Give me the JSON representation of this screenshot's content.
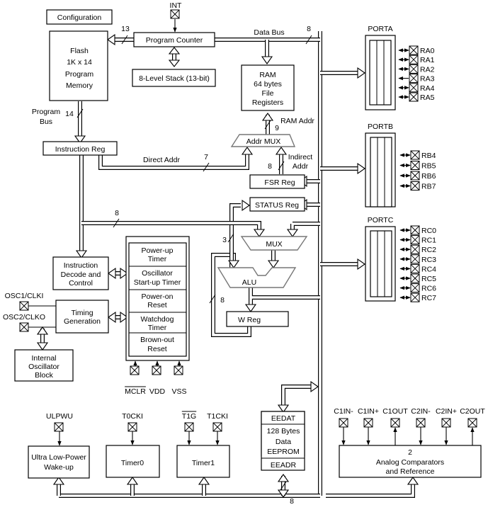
{
  "blocks": {
    "configuration": "Configuration",
    "flash": [
      "Flash",
      "1K x 14",
      "Program",
      "Memory"
    ],
    "program_counter": "Program Counter",
    "stack": "8-Level Stack (13-bit)",
    "ram": [
      "RAM",
      "64 bytes",
      "File",
      "Registers"
    ],
    "addr_mux": "Addr MUX",
    "fsr_reg": "FSR Reg",
    "status_reg": "STATUS Reg",
    "instruction_reg": "Instruction Reg",
    "instruction_decode": [
      "Instruction",
      "Decode and",
      "Control"
    ],
    "timing_generation": [
      "Timing",
      "Generation"
    ],
    "internal_oscillator": [
      "Internal",
      "Oscillator",
      "Block"
    ],
    "mux": "MUX",
    "alu": "ALU",
    "w_reg": "W Reg",
    "timers_stack": [
      [
        "Power-up",
        "Timer"
      ],
      [
        "Oscillator",
        "Start-up Timer"
      ],
      [
        "Power-on",
        "Reset"
      ],
      [
        "Watchdog",
        "Timer"
      ],
      [
        "Brown-out",
        "Reset"
      ]
    ],
    "ulpwu": [
      "Ultra Low-Power",
      "Wake-up"
    ],
    "timer0": "Timer0",
    "timer1": "Timer1",
    "eeprom": {
      "top": "EEDAT",
      "body": [
        "128 Bytes",
        "Data",
        "EEPROM"
      ],
      "bottom": "EEADR"
    },
    "comparators": [
      "2",
      "Analog Comparators",
      "and Reference"
    ]
  },
  "labels": {
    "data_bus": "Data Bus",
    "program_bus": [
      "Program",
      "Bus"
    ],
    "direct_addr": "Direct Addr",
    "ram_addr": "RAM Addr",
    "indirect_addr": [
      "Indirect",
      "Addr"
    ],
    "bus_widths": {
      "pc_to_flash": "13",
      "data_bus": "8",
      "program_bus": "14",
      "ram_addr": "9",
      "direct_addr": "7",
      "indirect_addr": "8",
      "literal": "8",
      "status_to_alu": "3",
      "w_feedback": "8",
      "eeprom": "8"
    }
  },
  "ports": [
    {
      "name": "PORTA",
      "pins": [
        "RA0",
        "RA1",
        "RA2",
        "RA3",
        "RA4",
        "RA5"
      ]
    },
    {
      "name": "PORTB",
      "pins": [
        "RB4",
        "RB5",
        "RB6",
        "RB7"
      ]
    },
    {
      "name": "PORTC",
      "pins": [
        "RC0",
        "RC1",
        "RC2",
        "RC3",
        "RC4",
        "RC5",
        "RC6",
        "RC7"
      ]
    }
  ],
  "pins": {
    "int": "INT",
    "osc1": "OSC1/CLKI",
    "osc2": "OSC2/CLKO",
    "mclr": "MCLR",
    "vdd": "VDD",
    "vss": "VSS",
    "ulpwu": "ULPWU",
    "t0cki": "T0CKI",
    "t1g": "T1G",
    "t1cki": "T1CKI",
    "comparator_pins": [
      "C1IN-",
      "C1IN+",
      "C1OUT",
      "C2IN-",
      "C2IN+",
      "C2OUT"
    ]
  }
}
